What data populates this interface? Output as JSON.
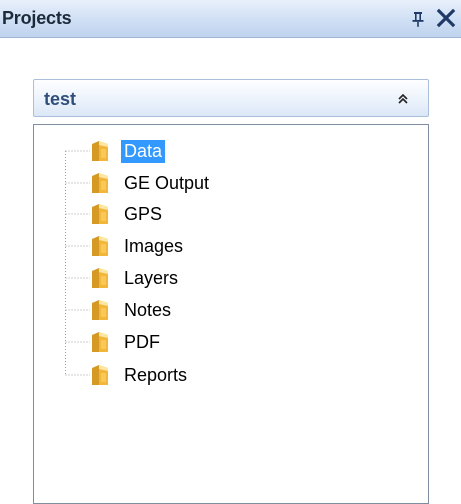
{
  "panel": {
    "title": "Projects",
    "pin_icon": "pin-icon",
    "close_icon": "close-icon"
  },
  "project": {
    "name": "test",
    "collapse_icon": "double-chevron-up-icon"
  },
  "tree": {
    "items": [
      {
        "label": "Data",
        "icon": "folder-icon",
        "selected": true
      },
      {
        "label": "GE Output",
        "icon": "folder-icon",
        "selected": false
      },
      {
        "label": "GPS",
        "icon": "folder-icon",
        "selected": false
      },
      {
        "label": "Images",
        "icon": "folder-icon",
        "selected": false
      },
      {
        "label": "Layers",
        "icon": "folder-icon",
        "selected": false
      },
      {
        "label": "Notes",
        "icon": "folder-icon",
        "selected": false
      },
      {
        "label": "PDF",
        "icon": "folder-icon",
        "selected": false
      },
      {
        "label": "Reports",
        "icon": "folder-icon",
        "selected": false
      }
    ]
  },
  "colors": {
    "header_gradient_top": "#e8f0fb",
    "header_gradient_bottom": "#bfd3ee",
    "group_title": "#2f4f7a",
    "selection": "#3399ff",
    "folder": "#f2b63a",
    "close": "#1f3a66"
  }
}
